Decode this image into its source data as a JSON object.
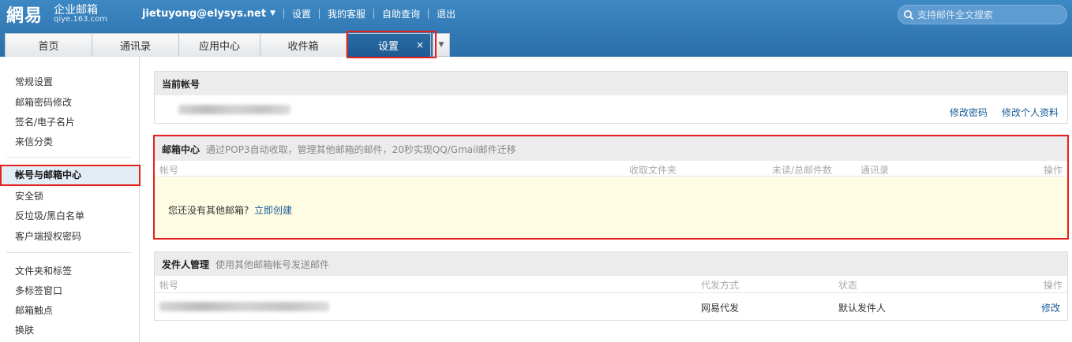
{
  "header": {
    "logo_main": "網易",
    "logo_sub": "企业邮箱",
    "logo_domain": "qiye.163.com",
    "user_email": "jietuyong@elysys.net",
    "links": [
      "设置",
      "我的客服",
      "自助查询",
      "退出"
    ],
    "search_placeholder": "支持邮件全文搜索"
  },
  "tabs": [
    {
      "label": "首页"
    },
    {
      "label": "通讯录"
    },
    {
      "label": "应用中心"
    },
    {
      "label": "收件箱"
    },
    {
      "label": "设置",
      "close": "×"
    }
  ],
  "sidebar": {
    "group1": [
      "常规设置",
      "邮箱密码修改",
      "签名/电子名片",
      "来信分类"
    ],
    "group2": [
      "帐号与邮箱中心",
      "安全锁",
      "反垃圾/黑白名单",
      "客户端授权密码"
    ],
    "group3": [
      "文件夹和标签",
      "多标签窗口",
      "邮箱触点",
      "换肤"
    ]
  },
  "current_account": {
    "title": "当前帐号",
    "change_password": "修改密码",
    "edit_profile": "修改个人资料"
  },
  "mailbox_center": {
    "title": "邮箱中心",
    "desc": "通过POP3自动收取，管理其他邮箱的邮件，20秒实现QQ/Gmail邮件迁移",
    "columns": {
      "account": "帐号",
      "folder": "收取文件夹",
      "count": "未读/总邮件数",
      "contacts": "通讯录",
      "action": "操作"
    },
    "empty_text": "您还没有其他邮箱?",
    "create_link": "立即创建"
  },
  "sender_mgmt": {
    "title": "发件人管理",
    "desc": "使用其他邮箱帐号发送邮件",
    "columns": {
      "account": "帐号",
      "method": "代发方式",
      "status": "状态",
      "action": "操作"
    },
    "rows": [
      {
        "method": "网易代发",
        "status": "默认发件人",
        "action": "修改"
      }
    ]
  },
  "colors": {
    "accent": "#2a6faa",
    "highlight": "#e3211d",
    "empty_bg": "#fefde3"
  }
}
